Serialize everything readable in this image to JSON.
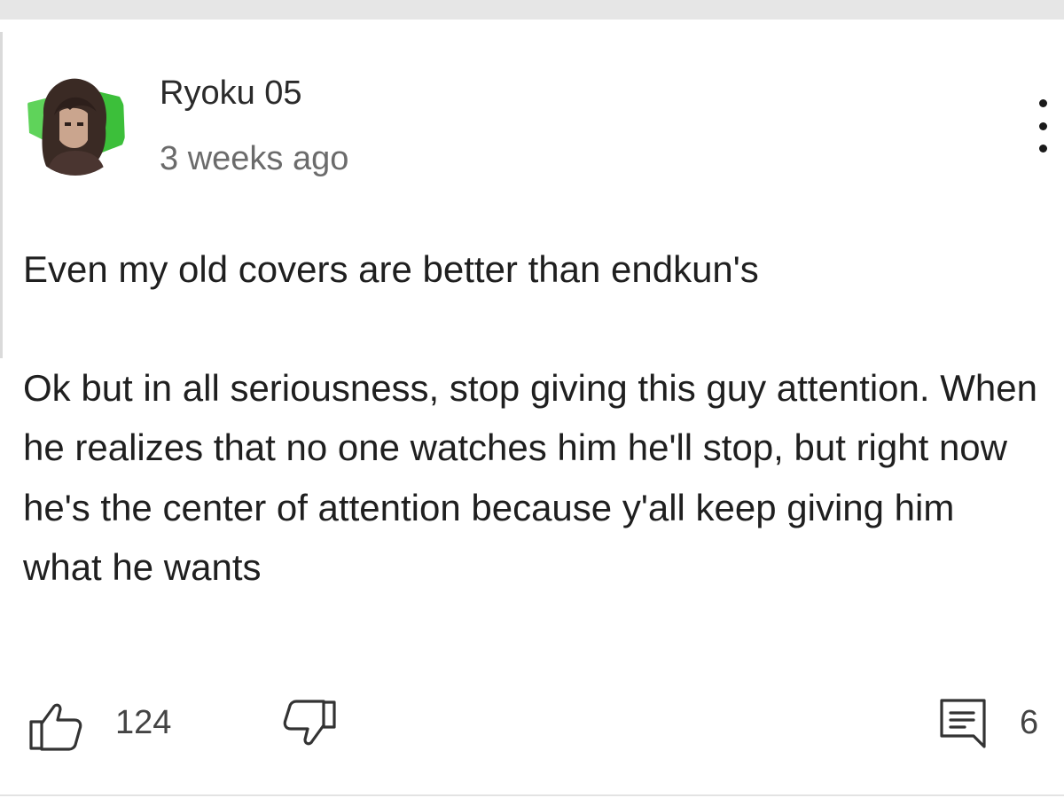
{
  "comment": {
    "author": "Ryoku 05",
    "timestamp": "3 weeks ago",
    "paragraphs": [
      "Even my old covers are better than endkun's",
      "Ok but in all seriousness, stop giving this guy attention. When he realizes that no one watches him he'll stop, but right now he's the center of attention because y'all keep giving him what he wants"
    ],
    "likes": "124",
    "replies": "6"
  },
  "icons": {
    "avatar": "avatar-anime-character",
    "menu": "more-vertical-icon",
    "like": "thumbs-up-icon",
    "dislike": "thumbs-down-icon",
    "reply": "comment-reply-icon"
  },
  "colors": {
    "avatar_accent": "#3cbf3a",
    "text_primary": "#1f1f1f",
    "text_secondary": "#6b6b6b"
  }
}
